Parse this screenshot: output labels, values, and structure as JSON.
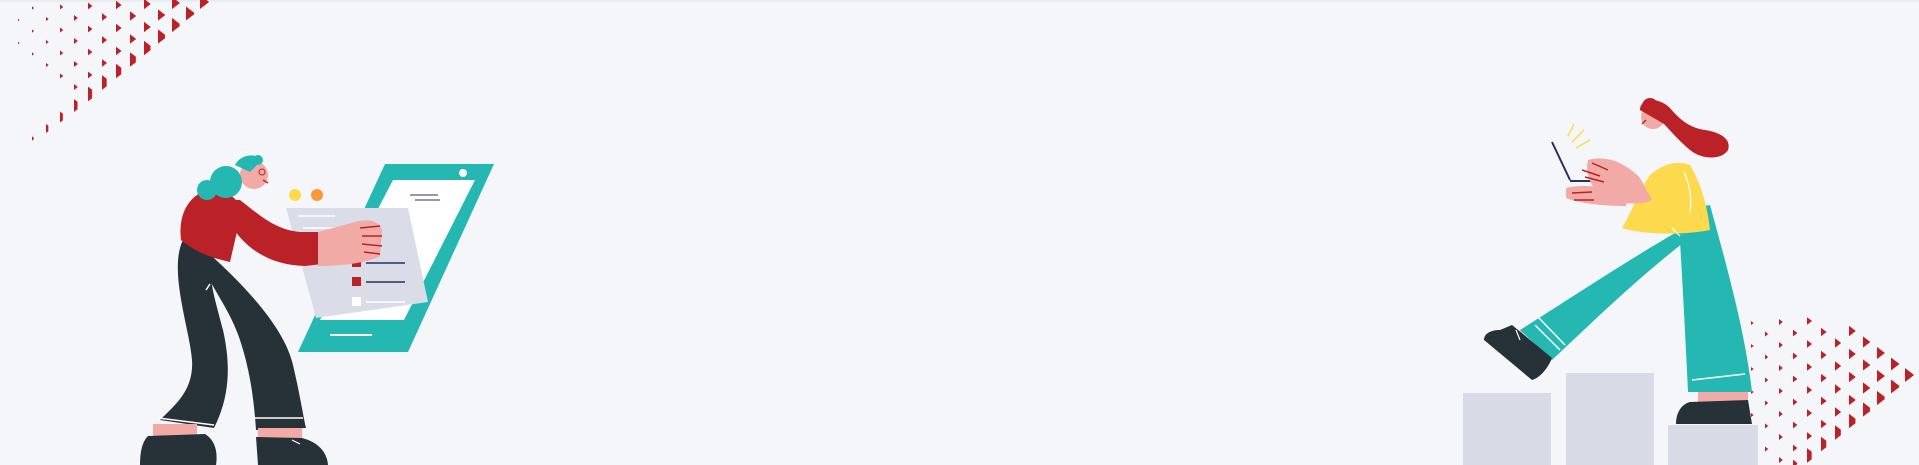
{
  "colors": {
    "background": "#f5f6fa",
    "accent_red": "#bb2227",
    "teal": "#25b8b2",
    "dark": "#263238",
    "skin": "#f2aaa6",
    "yellow": "#fcd94d",
    "orange": "#f89a33",
    "panel_grey": "#dadce8",
    "step_grey": "#d8dbe6",
    "ink": "#263062",
    "white": "#ffffff"
  },
  "icons": [
    "triangle-pattern",
    "tablet-checklist",
    "laptop"
  ]
}
